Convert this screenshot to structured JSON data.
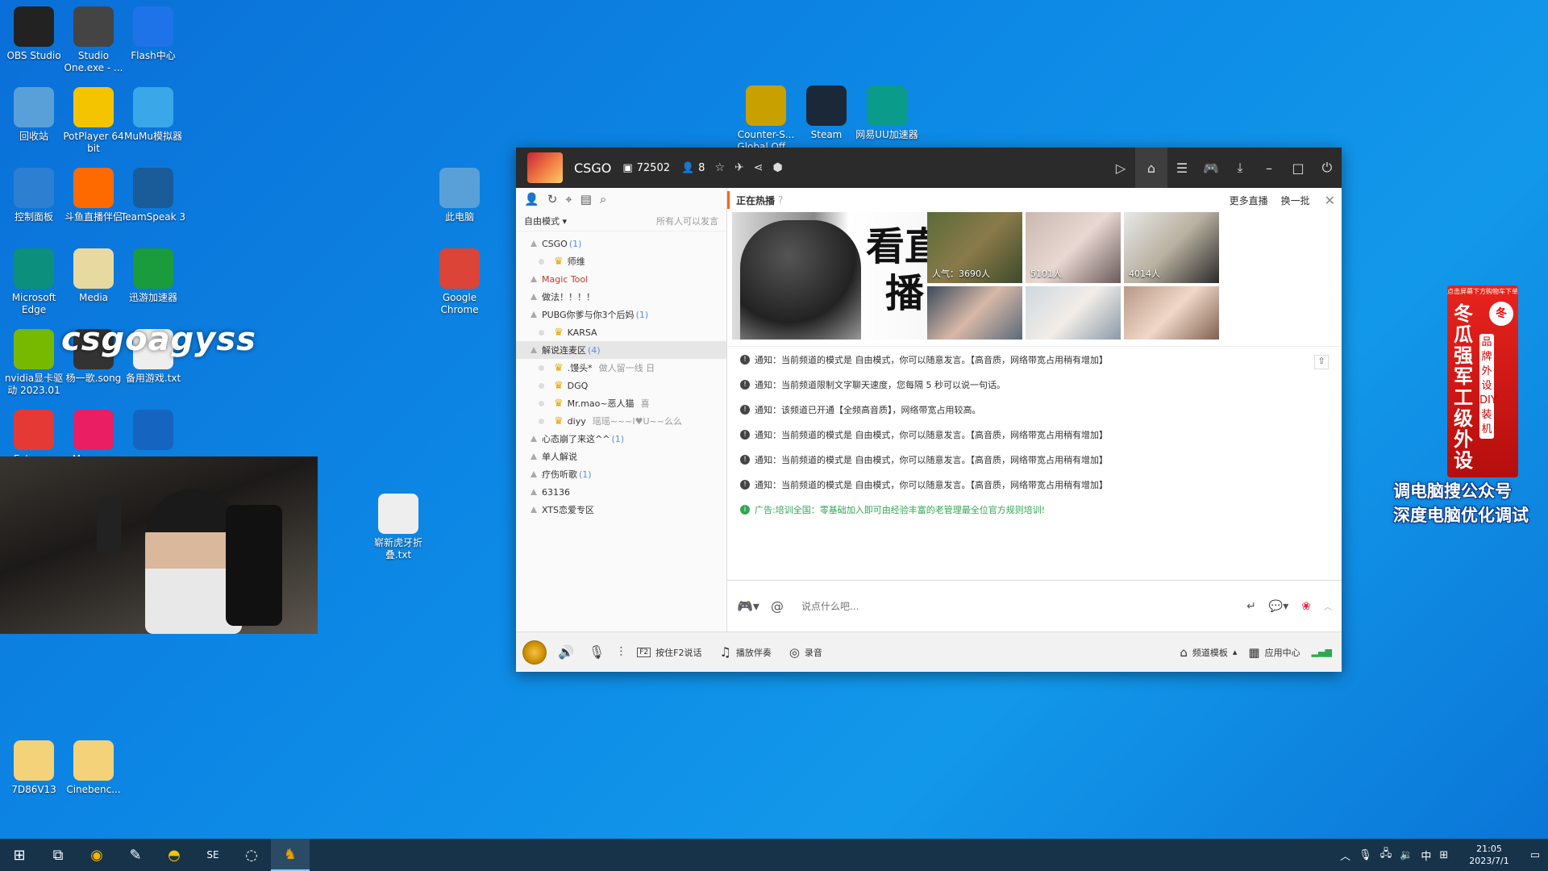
{
  "desktop_icons": [
    {
      "label": "OBS Studio",
      "color": "#222"
    },
    {
      "label": "Studio One.exe - ...",
      "color": "#444"
    },
    {
      "label": "Flash中心",
      "color": "#1e73e8"
    },
    {
      "label": "回收站",
      "color": "#5aa0d8"
    },
    {
      "label": "PotPlayer 64 bit",
      "color": "#f5c400"
    },
    {
      "label": "MuMu模拟器",
      "color": "#3aa7e8"
    },
    {
      "label": "控制面板",
      "color": "#2d7fd1"
    },
    {
      "label": "斗鱼直播伴侣",
      "color": "#ff6a00"
    },
    {
      "label": "TeamSpeak 3",
      "color": "#1a5b9a"
    },
    {
      "label": "Microsoft Edge",
      "color": "#0c8f7d"
    },
    {
      "label": "Media",
      "color": "#e8d9a0"
    },
    {
      "label": "迅游加速器",
      "color": "#1a9b3c"
    },
    {
      "label": "nvidia显卡驱动 2023.01",
      "color": "#76b900"
    },
    {
      "label": "杨一歌.song",
      "color": "#333"
    },
    {
      "label": "备用游戏.txt",
      "color": "#eee"
    },
    {
      "label": "Extreme",
      "color": "#e53935"
    },
    {
      "label": "Manager",
      "color": "#e91e63"
    },
    {
      "label": "",
      "color": "#1565c0"
    },
    {
      "label": "7D86V13",
      "color": "#f3d27a"
    },
    {
      "label": "Cinebenc...",
      "color": "#f3d27a"
    },
    {
      "label": "此电脑",
      "color": "#5aa0d8"
    },
    {
      "label": "Google Chrome",
      "color": "#db4437"
    },
    {
      "label": "崭新虎牙折叠.txt",
      "color": "#eee"
    },
    {
      "label": "Counter-S... Global Off...",
      "color": "#c8a000"
    },
    {
      "label": "Steam",
      "color": "#1b2838"
    },
    {
      "label": "网易UU加速器",
      "color": "#0a9b8a"
    }
  ],
  "watermark": "csgoagyss",
  "window": {
    "room_name": "CSGO",
    "room_id": "72502",
    "user_count": "8"
  },
  "left": {
    "mode": "自由模式",
    "mode_hint": "所有人可以发言",
    "tree": [
      {
        "name": "CSGO",
        "count": "(1)",
        "type": "channel"
      },
      {
        "name": "师维",
        "type": "user"
      },
      {
        "name": "Magic Tool",
        "type": "channel-red"
      },
      {
        "name": "做法！！！！",
        "type": "channel"
      },
      {
        "name": "PUBG你爹与你3个后妈",
        "count": "(1)",
        "type": "channel"
      },
      {
        "name": "KARSA",
        "type": "user"
      },
      {
        "name": "解说连麦区",
        "count": "(4)",
        "type": "channel-sel"
      },
      {
        "name": ".馒头*",
        "tag": "做人留一线 日",
        "type": "user"
      },
      {
        "name": "DGQ",
        "type": "user"
      },
      {
        "name": "Mr.mao~恶人猫",
        "tag": "喜",
        "type": "user"
      },
      {
        "name": "diyy",
        "tag": "瑶瑶~~~I♥U~~么么",
        "type": "user"
      },
      {
        "name": "心态崩了来这^^",
        "count": "(1)",
        "type": "channel"
      },
      {
        "name": "单人解说",
        "type": "channel"
      },
      {
        "name": "疗伤听歌",
        "count": "(1)",
        "type": "channel"
      },
      {
        "name": "63136",
        "type": "channel"
      },
      {
        "name": "XTS恋爱专区",
        "type": "channel"
      }
    ]
  },
  "hot": {
    "title": "正在热播",
    "help": "?",
    "more": "更多直播",
    "change": "换一批",
    "big_text": "看直播",
    "tiles": [
      {
        "pop": "人气：3690人"
      },
      {
        "pop": "5101人"
      },
      {
        "pop": "4014人"
      },
      {
        "pop": ""
      },
      {
        "pop": ""
      },
      {
        "pop": ""
      }
    ]
  },
  "messages": [
    {
      "text": "通知：当前频道的模式是 自由模式，你可以随意发言。【高音质，网络带宽占用稍有增加】",
      "ad": false
    },
    {
      "text": "通知：当前频道限制文字聊天速度，您每隔 5 秒可以说一句话。",
      "ad": false
    },
    {
      "text": "通知：该频道已开通【全频高音质】，网络带宽占用较高。",
      "ad": false
    },
    {
      "text": "通知：当前频道的模式是 自由模式，你可以随意发言。【高音质，网络带宽占用稍有增加】",
      "ad": false
    },
    {
      "text": "通知：当前频道的模式是 自由模式，你可以随意发言。【高音质，网络带宽占用稍有增加】",
      "ad": false
    },
    {
      "text": "通知：当前频道的模式是 自由模式，你可以随意发言。【高音质，网络带宽占用稍有增加】",
      "ad": false
    },
    {
      "text": "广告:培训全国：零基础加入即可由经验丰富的老管理最全位官方规则培训!",
      "ad": true
    }
  ],
  "input": {
    "placeholder": "说点什么吧..."
  },
  "bottom": {
    "f2": "按住F2说话",
    "music": "播放伴奏",
    "record": "录音",
    "template": "频道模板",
    "apps": "应用中心"
  },
  "promo": {
    "top": "点击屏幕下方购物车下单",
    "col1": "冬瓜强军工级外设",
    "col2": "品牌外设DIY装机",
    "line1": "调电脑搜公众号",
    "line2": "深度电脑优化调试"
  },
  "taskbar": {
    "time": "21:05",
    "date": "2023/7/1",
    "ime": "中"
  }
}
